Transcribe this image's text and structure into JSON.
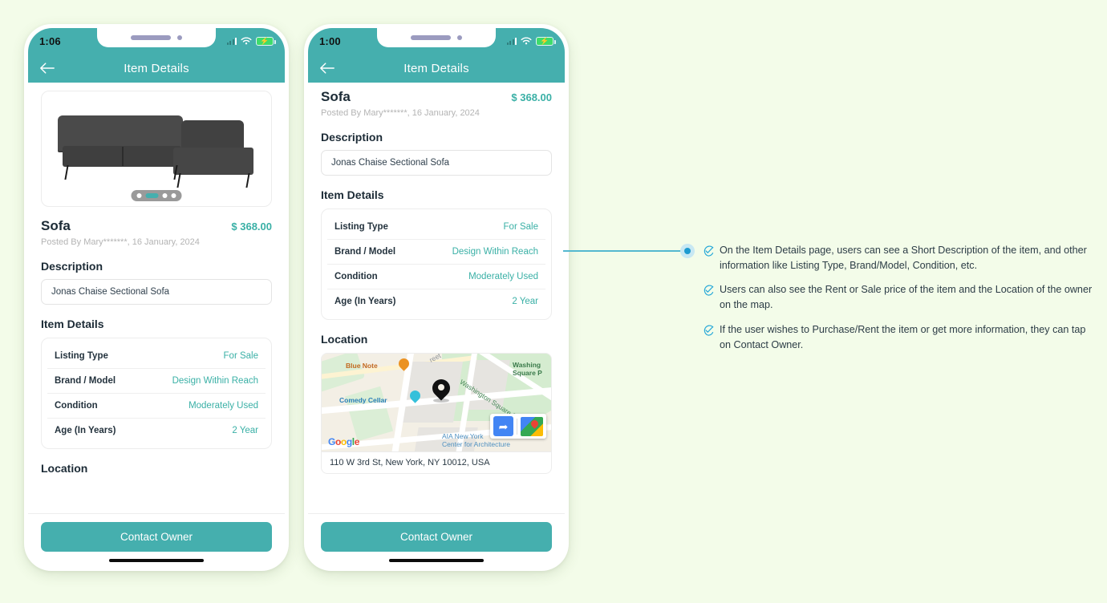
{
  "page": {
    "background_color": "#f3fce9",
    "accent_teal": "#45afae",
    "value_teal": "#3ab0a6",
    "annotation_blue": "#1e9bd0"
  },
  "phones": [
    {
      "id": "phone-1",
      "status": {
        "time": "1:06",
        "signal_icon": "signal-bars-icon",
        "wifi_icon": "wifi-icon",
        "battery_icon": "battery-charging-icon",
        "battery_bolt": "⚡"
      },
      "appbar": {
        "back_icon": "back-arrow-icon",
        "title": "Item Details"
      },
      "hero": {
        "image_alt": "sofa-photo",
        "dots": [
          "inactive",
          "active",
          "inactive",
          "inactive"
        ]
      },
      "item": {
        "title": "Sofa",
        "price": "$ 368.00",
        "posted": "Posted By Mary*******, 16 January, 2024"
      },
      "description": {
        "heading": "Description",
        "value": "Jonas Chaise Sectional Sofa"
      },
      "details": {
        "heading": "Item Details",
        "rows": [
          {
            "key": "Listing Type",
            "value": "For Sale"
          },
          {
            "key": "Brand / Model",
            "value": "Design Within Reach"
          },
          {
            "key": "Condition",
            "value": "Moderately Used"
          },
          {
            "key": "Age (In Years)",
            "value": "2 Year"
          }
        ]
      },
      "location": {
        "heading": "Location"
      },
      "footer": {
        "cta_label": "Contact Owner"
      }
    },
    {
      "id": "phone-2",
      "status": {
        "time": "1:00",
        "signal_icon": "signal-bars-icon",
        "wifi_icon": "wifi-icon",
        "battery_icon": "battery-charging-icon",
        "battery_bolt": "⚡"
      },
      "appbar": {
        "back_icon": "back-arrow-icon",
        "title": "Item Details"
      },
      "item": {
        "title": "Sofa",
        "price": "$ 368.00",
        "posted": "Posted By Mary*******, 16 January, 2024"
      },
      "description": {
        "heading": "Description",
        "value": "Jonas Chaise Sectional Sofa"
      },
      "details": {
        "heading": "Item Details",
        "rows": [
          {
            "key": "Listing Type",
            "value": "For Sale"
          },
          {
            "key": "Brand / Model",
            "value": "Design Within Reach"
          },
          {
            "key": "Condition",
            "value": "Moderately Used"
          },
          {
            "key": "Age (In Years)",
            "value": "2 Year"
          }
        ]
      },
      "location": {
        "heading": "Location",
        "address": "110 W 3rd St, New York, NY 10012, USA",
        "map": {
          "brand": "Google",
          "labels": {
            "blue_note": "Blue Note",
            "comedy_cellar": "Comedy Cellar",
            "washington_square_park": "Washing\nSquare P",
            "washington_square_s": "Washington Square S",
            "street": "reet",
            "aia": "AIA New York\nCenter for Architecture"
          },
          "directions_icon": "directions-arrow-icon",
          "open_maps_icon": "google-maps-icon",
          "marker_icon": "map-pin-icon"
        }
      },
      "footer": {
        "cta_label": "Contact Owner"
      }
    }
  ],
  "annotation": {
    "bullet_icon": "check-circle-icon",
    "notes": [
      "On the Item Details page, users can see a Short Description of the item, and other information like Listing Type, Brand/Model, Condition, etc.",
      "Users can also see the Rent or Sale price of the item and the Location of the owner on the map.",
      "If the user wishes to Purchase/Rent the item or get more information, they can tap on Contact Owner."
    ]
  }
}
